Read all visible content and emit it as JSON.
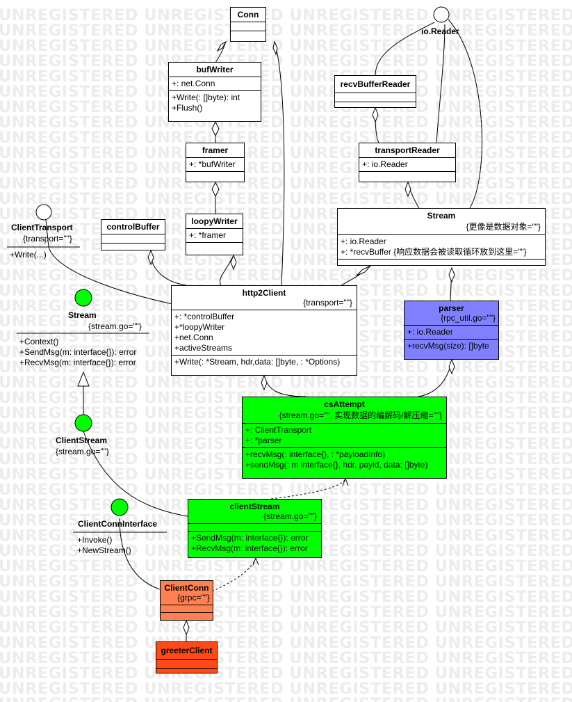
{
  "watermark": "UNREGISTERED",
  "colors": {
    "green": "#00ff00",
    "purple": "#8080ff",
    "orange": "#ff8050",
    "red_orange": "#ff4a14"
  },
  "classes": {
    "conn": {
      "name": "Conn"
    },
    "bufwriter": {
      "name": "bufWriter",
      "attrs": [
        "+: net.Conn"
      ],
      "ops": [
        "+Write(: []byte): int",
        "+Flush()"
      ]
    },
    "framer": {
      "name": "framer",
      "attrs": [
        "+: *bufWriter"
      ]
    },
    "loopywriter": {
      "name": "loopyWriter",
      "attrs": [
        "+: *framer"
      ]
    },
    "controlbuffer": {
      "name": "controlBuffer"
    },
    "recvbufferreader": {
      "name": "recvBufferReader"
    },
    "transportreader": {
      "name": "transportReader",
      "attrs": [
        "+: io.Reader"
      ]
    },
    "stream_struct": {
      "name": "Stream",
      "tag": "{更像是数据对象=\"\"}",
      "attrs": [
        "+: io.Reader",
        "+: *recvBuffer {响应数据会被读取循环放到这里=\"\"}"
      ]
    },
    "http2client": {
      "name": "http2Client",
      "tag": "{transport=\"\"}",
      "attrs": [
        "+: *controlBuffer",
        "+*loopyWriter",
        "+net.Conn",
        "+activeStreams"
      ],
      "ops": [
        "+Write(: *Stream, hdr,data: []byte, : *Options)"
      ]
    },
    "parser": {
      "name": "parser",
      "tag": "{rpc_util.go=\"\"}",
      "attrs": [
        "+: io.Reader"
      ],
      "ops": [
        "+recvMsg(size): []byte"
      ]
    },
    "csattempt": {
      "name": "csAttempt",
      "tag": "{stream.go=\"\", 实现数据的编解码/解压缩=\"\"}",
      "attrs": [
        "+: ClientTransport",
        "+: *parser"
      ],
      "ops": [
        "+recvMsg(: interface{}, : *payloadInfo)",
        "+sendMsg(: m interface{}, hdr, payld, data: []byte)"
      ]
    },
    "clientstream": {
      "name": "clientStream",
      "tag": "{stream.go=\"\"}",
      "ops": [
        "+SendMsg(m: interface{}): error",
        "+RecvMsg(m: interface{}): error"
      ]
    },
    "clientconn": {
      "name": "ClientConn",
      "tag": "{grpc=\"\"}"
    },
    "greeterclient": {
      "name": "greeterClient"
    }
  },
  "interfaces": {
    "ioreader": {
      "name": "io.Reader"
    },
    "clienttransport": {
      "name": "ClientTransport",
      "tag": "{transport=\"\"}",
      "ops": [
        "+Write(...)"
      ]
    },
    "stream_iface": {
      "name": "Stream",
      "tag": "{stream.go=\"\"}",
      "ops": [
        "+Context()",
        "+SendMsg(m: interface{}): error",
        "+RecvMsg(m: interface{}): error"
      ]
    },
    "clientstream_iface": {
      "name": "ClientStream",
      "tag": "{stream.go=\"\"}"
    },
    "clientconninterface": {
      "name": "ClientConnInterface",
      "ops": [
        "+Invoke()",
        "+NewStream()"
      ]
    }
  }
}
